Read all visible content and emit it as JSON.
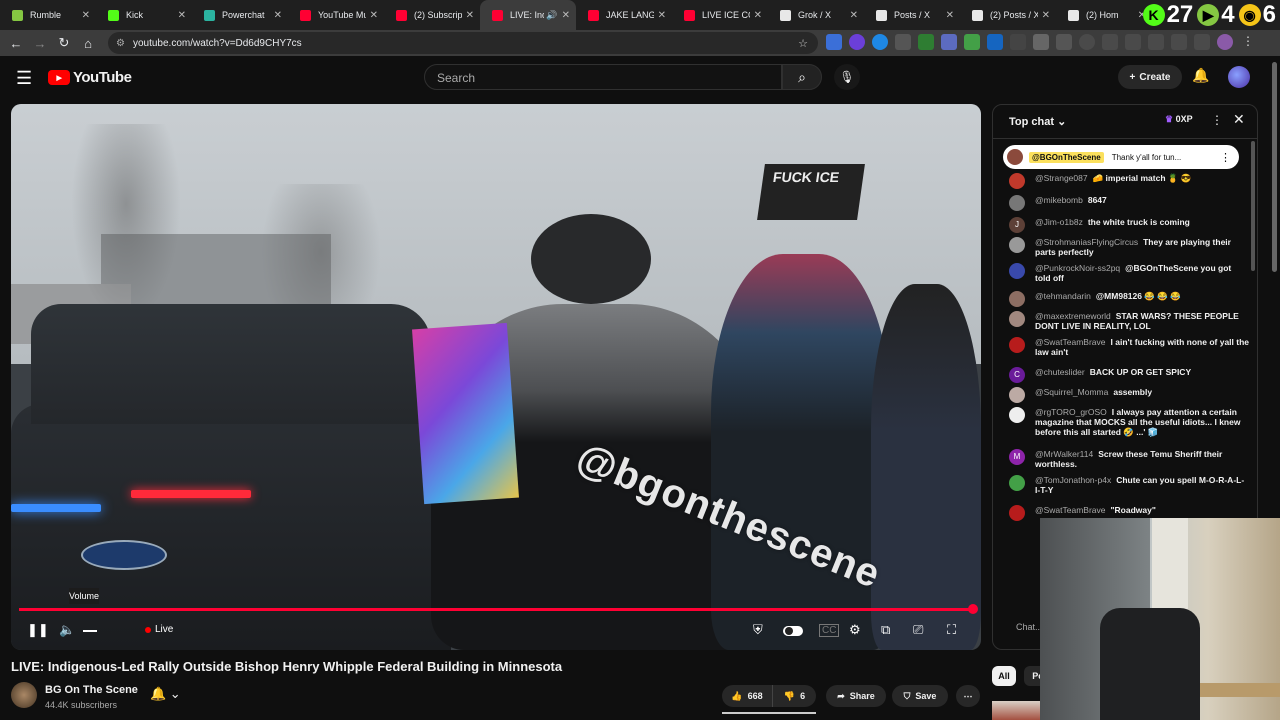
{
  "browser": {
    "tabs": [
      {
        "label": "Rumble",
        "color": "#85c742"
      },
      {
        "label": "Kick",
        "color": "#53fc18"
      },
      {
        "label": "Powerchat",
        "color": "#2bb3a0"
      },
      {
        "label": "YouTube Mu",
        "color": "#ff0033"
      },
      {
        "label": "(2) Subscripti",
        "color": "#ff0033"
      },
      {
        "label": "LIVE: Indi",
        "color": "#ff0033",
        "active": true
      },
      {
        "label": "JAKE LANG 2",
        "color": "#ff0033"
      },
      {
        "label": "LIVE ICE COU",
        "color": "#ff0033"
      },
      {
        "label": "Grok / X",
        "color": "#e8e8e8"
      },
      {
        "label": "Posts / X",
        "color": "#e8e8e8"
      },
      {
        "label": "(2) Posts / X",
        "color": "#e8e8e8"
      },
      {
        "label": "(2) Hom",
        "color": "#e8e8e8"
      }
    ],
    "url": "youtube.com/watch?v=Dd6d9CHY7cs",
    "counters": [
      {
        "badge": "K",
        "color": "#53fc18",
        "value": "27"
      },
      {
        "badge": "▶",
        "color": "#85c742",
        "value": "4"
      },
      {
        "badge": "◉",
        "color": "#f5c518",
        "value": "6"
      }
    ]
  },
  "youtube": {
    "logo_text": "YouTube",
    "search_placeholder": "Search",
    "create_label": "Create"
  },
  "player": {
    "watermark": "@bgonthescene",
    "flag_text": "FUCK ICE",
    "volume_tooltip": "Volume",
    "live_label": "Live",
    "progress": 1.0
  },
  "video": {
    "title": "LIVE: Indigenous-Led Rally Outside Bishop Henry Whipple Federal Building in Minnesota",
    "channel_name": "BG On The Scene",
    "subscribers": "44.4K subscribers",
    "likes": "668",
    "dislikes": "6",
    "share_label": "Share",
    "save_label": "Save"
  },
  "chat": {
    "header": "Top chat",
    "xp": "0XP",
    "pinned": {
      "author": "@BGOnTheScene",
      "text": "Thank y'all for tun..."
    },
    "messages": [
      {
        "author": "@Strange087",
        "text": "🧀 imperial match 🍍 😎",
        "color": "#c0392b",
        "initial": ""
      },
      {
        "author": "@mikebomb",
        "text": "8647",
        "color": "#777",
        "initial": ""
      },
      {
        "author": "@Jim-o1b8z",
        "text": "the white truck is coming",
        "color": "#5d4037",
        "initial": "J"
      },
      {
        "author": "@StrohmaniasFlyingCircus",
        "text": "They are playing their parts perfectly",
        "color": "#999",
        "initial": ""
      },
      {
        "author": "@PunkrockNoir-ss2pq",
        "text": "@BGOnTheScene you got told off",
        "color": "#3949ab",
        "initial": ""
      },
      {
        "author": "@tehmandarin",
        "text": "@MM98126 😂 😂 😂",
        "color": "#8d6e63",
        "initial": ""
      },
      {
        "author": "@maxextremeworld",
        "text": "STAR WARS? THESE PEOPLE DONT LIVE IN REALITY, LOL",
        "color": "#a1887f",
        "initial": ""
      },
      {
        "author": "@SwatTeamBrave",
        "text": "I ain't fucking with none of yall the law ain't",
        "color": "#b71c1c",
        "initial": ""
      },
      {
        "author": "@chuteslider",
        "text": "BACK UP OR GET SPICY",
        "color": "#6a1b9a",
        "initial": "C"
      },
      {
        "author": "@Squirrel_Momma",
        "text": "assembly",
        "color": "#bcaaa4",
        "initial": ""
      },
      {
        "author": "@rgTORO_grOSO",
        "text": "I always pay attention a certain magazine that MOCKS all the useful idiots... I knew before this all started 🤣 ...' 🧊",
        "color": "#eee",
        "initial": ""
      },
      {
        "author": "@MrWalker114",
        "text": "Screw these Temu Sheriff their worthless.",
        "color": "#8e24aa",
        "initial": "M"
      },
      {
        "author": "@TomJonathon-p4x",
        "text": "Chute can you spell M-O-R-A-L-I-T-Y",
        "color": "#43a047",
        "initial": ""
      },
      {
        "author": "@SwatTeamBrave",
        "text": "\"Roadway\"",
        "color": "#b71c1c",
        "initial": ""
      }
    ],
    "input_placeholder": "Chat...",
    "chips": [
      "All",
      "Po"
    ]
  },
  "colors": {
    "accent": "#ff0033",
    "pinned_bg": "#ffffff",
    "pinned_author_bg": "#fbe05d"
  }
}
